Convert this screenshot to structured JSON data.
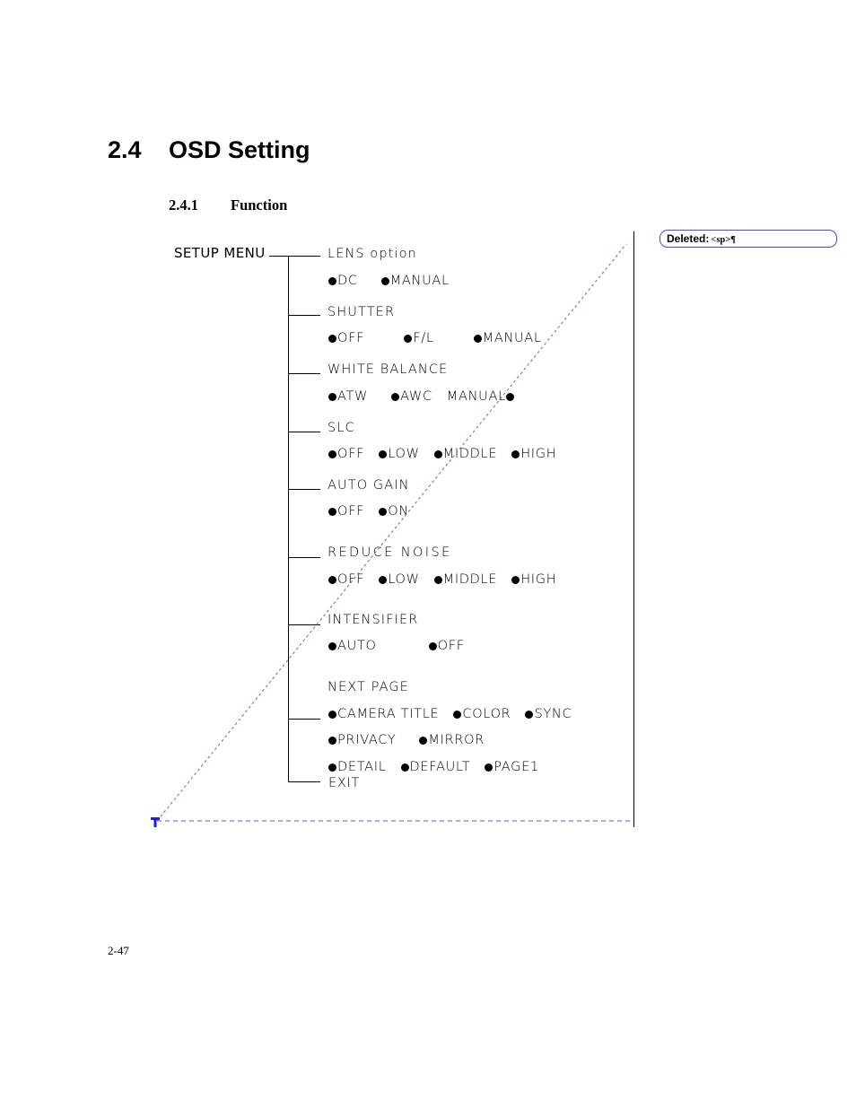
{
  "document": {
    "heading": {
      "number": "2.4",
      "title": "OSD Setting"
    },
    "subheading": {
      "number": "2.4.1",
      "title": "Function"
    },
    "footer": {
      "page_number": "2-47"
    }
  },
  "revision": {
    "changebar_color": "#000000",
    "callout": {
      "label": "Deleted:",
      "value": "<sp>¶",
      "border_color": "#4a4ad0"
    },
    "leader_line_color": "#7b7bd8",
    "anchor_marker_color": "#1a1aee"
  },
  "diagram": {
    "root_label": "SETUP MENU",
    "sections": [
      {
        "header": "LENS option",
        "options": [
          {
            "label": "DC",
            "bullet": "leading"
          },
          {
            "label": "MANUAL",
            "bullet": "leading"
          }
        ]
      },
      {
        "header": "SHUTTER",
        "options": [
          {
            "label": "OFF",
            "bullet": "leading"
          },
          {
            "label": "F/L",
            "bullet": "leading"
          },
          {
            "label": "MANUAL",
            "bullet": "leading"
          }
        ]
      },
      {
        "header": "WHITE BALANCE",
        "options": [
          {
            "label": "ATW",
            "bullet": "leading"
          },
          {
            "label": "AWC",
            "bullet": "leading"
          },
          {
            "label": "MANUAL",
            "bullet": "trailing"
          }
        ]
      },
      {
        "header": "SLC",
        "options": [
          {
            "label": "OFF",
            "bullet": "leading"
          },
          {
            "label": "LOW",
            "bullet": "leading"
          },
          {
            "label": "MIDDLE",
            "bullet": "leading"
          },
          {
            "label": "HIGH",
            "bullet": "leading"
          }
        ]
      },
      {
        "header": "AUTO GAIN",
        "options": [
          {
            "label": "OFF",
            "bullet": "leading"
          },
          {
            "label": "ON",
            "bullet": "leading"
          }
        ]
      },
      {
        "header": "REDUCE NOISE",
        "options": [
          {
            "label": "OFF",
            "bullet": "leading"
          },
          {
            "label": "LOW",
            "bullet": "leading"
          },
          {
            "label": "MIDDLE",
            "bullet": "leading"
          },
          {
            "label": "HIGH",
            "bullet": "leading"
          }
        ]
      },
      {
        "header": "INTENSIFIER",
        "options": [
          {
            "label": "AUTO",
            "bullet": "leading"
          },
          {
            "label": "OFF",
            "bullet": "leading"
          }
        ]
      },
      {
        "header": "NEXT PAGE",
        "options": [
          {
            "label": "CAMERA TITLE",
            "bullet": "leading"
          },
          {
            "label": "COLOR",
            "bullet": "leading"
          },
          {
            "label": "SYNC",
            "bullet": "leading"
          },
          {
            "label": "PRIVACY",
            "bullet": "leading"
          },
          {
            "label": "MIRROR",
            "bullet": "leading"
          },
          {
            "label": "DETAIL",
            "bullet": "leading"
          },
          {
            "label": "DEFAULT",
            "bullet": "leading"
          },
          {
            "label": "PAGE1",
            "bullet": "leading"
          }
        ]
      }
    ],
    "exit_label": "EXIT",
    "labels": {
      "lens_header": "LENS option",
      "lens_opt_dc": "DC",
      "lens_opt_manual": "MANUAL",
      "shutter_header": "SHUTTER",
      "shutter_opt_off": "OFF",
      "shutter_opt_fl": "F/L",
      "shutter_opt_manual": "MANUAL",
      "wb_header": "WHITE BALANCE",
      "wb_opt_atw": "ATW",
      "wb_opt_awc": "AWC",
      "wb_opt_manual": "MANUAL",
      "slc_header": "SLC",
      "slc_opt_off": "OFF",
      "slc_opt_low": "LOW",
      "slc_opt_middle": "MIDDLE",
      "slc_opt_high": "HIGH",
      "ag_header": "AUTO GAIN",
      "ag_opt_off": "OFF",
      "ag_opt_on": "ON",
      "rn_header": "REDUCE NOISE",
      "rn_opt_off": "OFF",
      "rn_opt_low": "LOW",
      "rn_opt_middle": "MIDDLE",
      "rn_opt_high": "HIGH",
      "int_header": "INTENSIFIER",
      "int_opt_auto": "AUTO",
      "int_opt_off": "OFF",
      "np_header": "NEXT PAGE",
      "np_opt_camera_title": "CAMERA TITLE",
      "np_opt_color": "COLOR",
      "np_opt_sync": "SYNC",
      "np_opt_privacy": "PRIVACY",
      "np_opt_mirror": "MIRROR",
      "np_opt_detail": "DETAIL",
      "np_opt_default": "DEFAULT",
      "np_opt_page1": "PAGE1",
      "exit": "EXIT"
    }
  }
}
